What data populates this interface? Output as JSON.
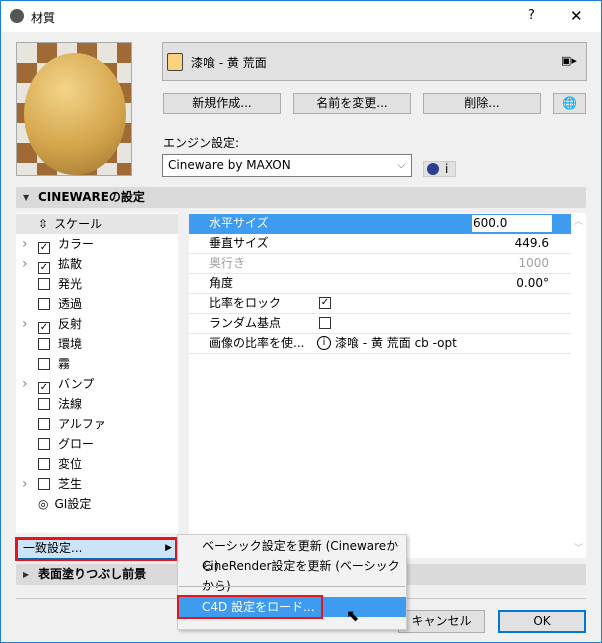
{
  "window": {
    "title": "材質",
    "help": "?",
    "close": "✕"
  },
  "material": {
    "name": "漆喰 - 黄 荒面",
    "swatch_color": "#fcd27f"
  },
  "buttons": {
    "new": "新規作成...",
    "rename": "名前を変更...",
    "delete": "削除..."
  },
  "engine": {
    "label": "エンジン設定:",
    "value": "Cineware by MAXON",
    "info": "i"
  },
  "section1": {
    "title": "CINEWAREの設定"
  },
  "channels": [
    {
      "label": "スケール",
      "type": "scale",
      "selected": true
    },
    {
      "label": "カラー",
      "checked": true,
      "expand": true
    },
    {
      "label": "拡散",
      "checked": true,
      "expand": true
    },
    {
      "label": "発光",
      "checked": false
    },
    {
      "label": "透過",
      "checked": false
    },
    {
      "label": "反射",
      "checked": true,
      "expand": true
    },
    {
      "label": "環境",
      "checked": false
    },
    {
      "label": "霧",
      "checked": false
    },
    {
      "label": "バンプ",
      "checked": true,
      "expand": true
    },
    {
      "label": "法線",
      "checked": false
    },
    {
      "label": "アルファ",
      "checked": false
    },
    {
      "label": "グロー",
      "checked": false
    },
    {
      "label": "変位",
      "checked": false
    },
    {
      "label": "芝生",
      "checked": false,
      "expand": true
    },
    {
      "label": "GI設定",
      "type": "gi"
    }
  ],
  "properties": {
    "h_size": {
      "label": "水平サイズ",
      "value": "600.0"
    },
    "v_size": {
      "label": "垂直サイズ",
      "value": "449.6"
    },
    "depth": {
      "label": "奥行き",
      "value": "1000"
    },
    "angle": {
      "label": "角度",
      "value": "0.00°"
    },
    "lock": {
      "label": "比率をロック",
      "checked": true
    },
    "random": {
      "label": "ランダム基点",
      "checked": false
    },
    "image_ratio": {
      "label": "画像の比率を使...",
      "value": "漆喰 - 黄 荒面 cb -opt"
    }
  },
  "match_button": "一致設定...",
  "section2": {
    "title": "表面塗りつぶし前景"
  },
  "menu": {
    "items": [
      "ベーシック設定を更新 (Cinewareから)",
      "CineRender設定を更新 (ベーシックから)",
      "C4D 設定をロード..."
    ]
  },
  "footer": {
    "cancel": "キャンセル",
    "ok": "OK"
  }
}
